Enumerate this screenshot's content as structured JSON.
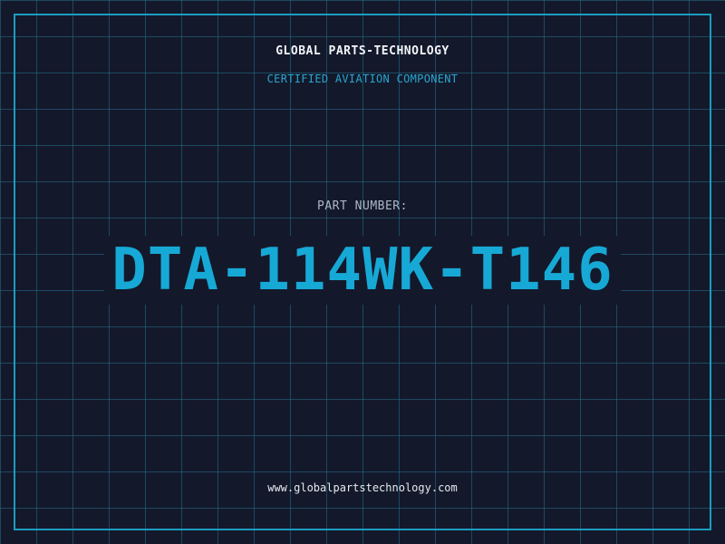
{
  "header": {
    "brand": "GLOBAL PARTS-TECHNOLOGY",
    "subtitle": "CERTIFIED AVIATION COMPONENT"
  },
  "part": {
    "label": "PART NUMBER:",
    "number": "DTA-114WK-T146"
  },
  "footer": {
    "website": "www.globalpartstechnology.com"
  },
  "colors": {
    "background": "#13192b",
    "grid": "#24708a",
    "frame": "#1e9cc2",
    "accent": "#17a9d6",
    "subtitle": "#2aa6d0",
    "label": "#aeb6c4",
    "text": "#f2f4f8"
  }
}
